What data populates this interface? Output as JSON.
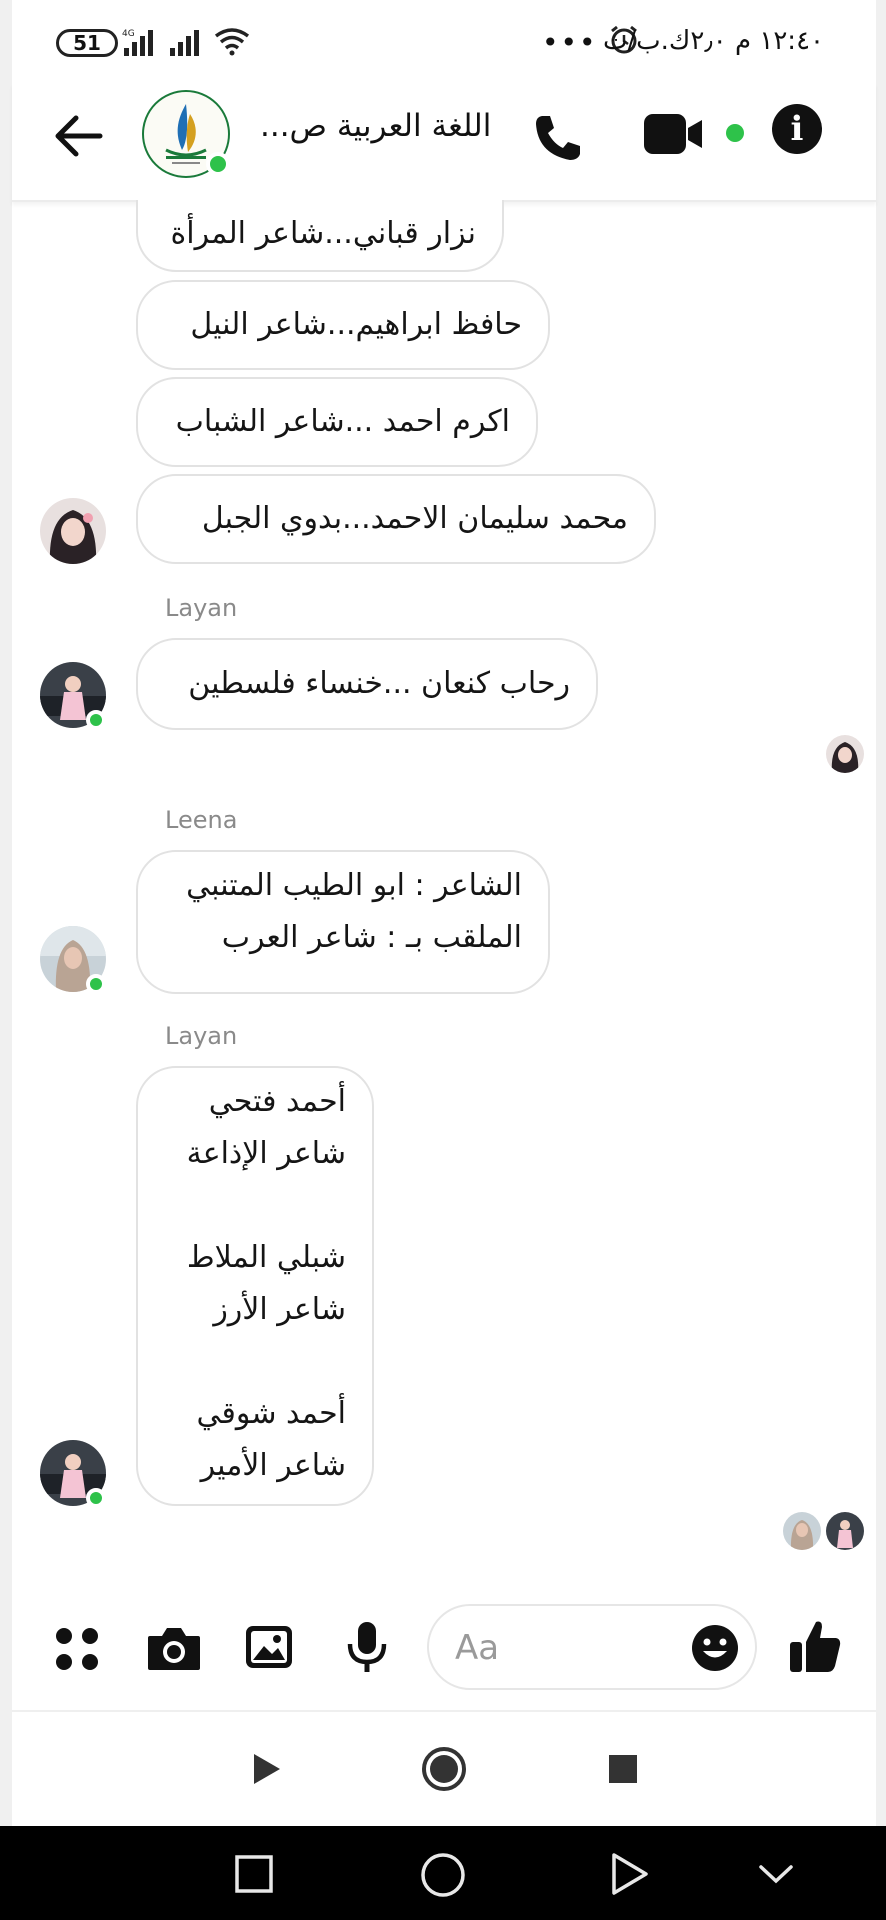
{
  "status_bar": {
    "battery": "51",
    "time": "١٢:٤٠ م ٢٫٠ك.ب/ث",
    "more": "•••"
  },
  "header": {
    "title": "اللغة العربية ص..."
  },
  "messages": [
    {
      "text": "نزار قباني...شاعر المرأة"
    },
    {
      "text": "حافظ ابراهيم...شاعر النيل"
    },
    {
      "text": "اكرم احمد ...شاعر الشباب"
    },
    {
      "text": "محمد سليمان الاحمد...بدوي الجبل"
    },
    {
      "sender": "Layan",
      "text": "رحاب كنعان ...خنساء فلسطين"
    },
    {
      "sender": "Leena",
      "lines": [
        "الشاعر : ابو الطيب المتنبي",
        "الملقب بـ : شاعر العرب"
      ]
    },
    {
      "sender": "Layan",
      "lines": [
        "أحمد فتحي",
        "شاعر الإذاعة",
        "",
        "شبلي الملاط",
        "شاعر الأرز",
        "",
        "أحمد شوقي",
        "شاعر الأمير"
      ]
    }
  ],
  "composer": {
    "placeholder": "Aa"
  },
  "colors": {
    "online": "#2ec24a",
    "bubble_border": "#e2e2e2",
    "sender_label": "#8a8a8a",
    "system_nav": "#000000"
  }
}
